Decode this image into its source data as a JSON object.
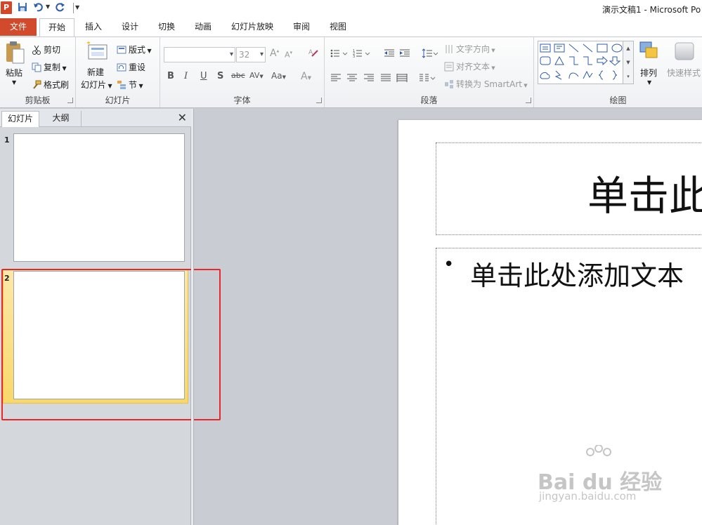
{
  "window": {
    "app_icon": "P",
    "title": "演示文稿1 - Microsoft Po"
  },
  "tabs": {
    "file": "文件",
    "items": [
      "开始",
      "插入",
      "设计",
      "切换",
      "动画",
      "幻灯片放映",
      "审阅",
      "视图"
    ]
  },
  "ribbon": {
    "clipboard": {
      "paste": "粘贴",
      "cut": "剪切",
      "copy": "复制",
      "format_painter": "格式刷",
      "label": "剪贴板"
    },
    "slides": {
      "new_slide_1": "新建",
      "new_slide_2": "幻灯片",
      "layout": "版式",
      "reset": "重设",
      "section": "节",
      "label": "幻灯片"
    },
    "font": {
      "size": "32",
      "grow": "A",
      "shrink": "A",
      "bold": "B",
      "italic": "I",
      "underline": "U",
      "shadow": "S",
      "strike": "abc",
      "spacing": "AV",
      "case": "Aa",
      "color": "A",
      "label": "字体"
    },
    "paragraph": {
      "text_direction": "文字方向",
      "align_text": "对齐文本",
      "smartart": "转换为 SmartArt",
      "label": "段落"
    },
    "drawing": {
      "arrange": "排列",
      "quick_styles": "快速样式",
      "label": "绘图"
    }
  },
  "panel": {
    "tab_slides": "幻灯片",
    "tab_outline": "大纲",
    "close": "✕",
    "slide_numbers": [
      "1",
      "2"
    ]
  },
  "slide": {
    "title_placeholder": "单击此",
    "bullet": "•",
    "body_placeholder": "单击此处添加文本"
  },
  "watermark": {
    "brand": "Bai du 经验",
    "url": "jingyan.baidu.com"
  }
}
